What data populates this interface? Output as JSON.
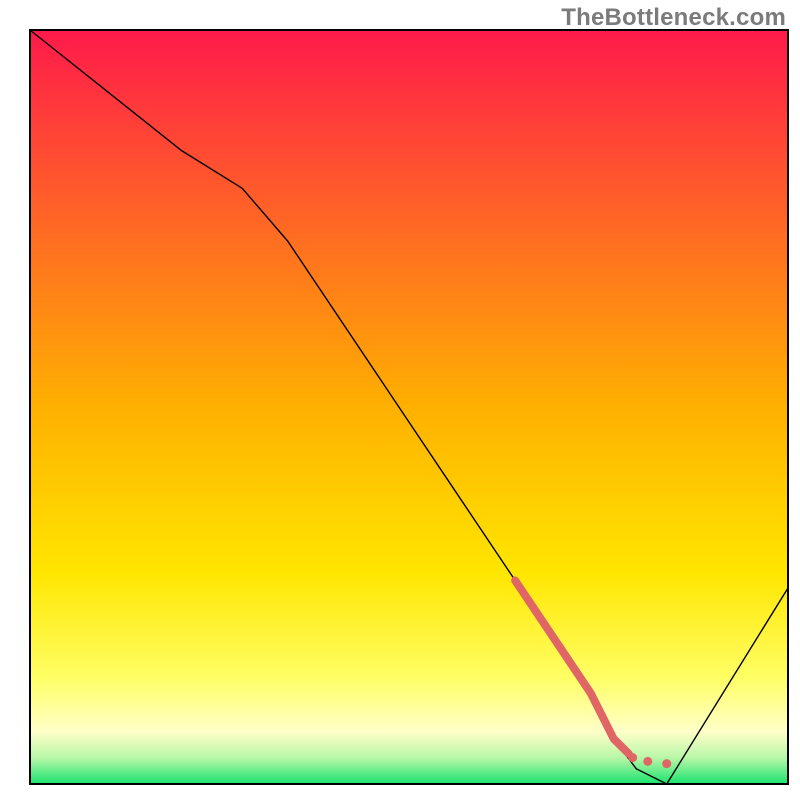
{
  "watermark": "TheBottleneck.com",
  "chart_data": {
    "type": "line",
    "title": "",
    "xlabel": "",
    "ylabel": "",
    "xlim": [
      0,
      100
    ],
    "ylim": [
      0,
      100
    ],
    "axes_visible": false,
    "background_gradient": {
      "orientation": "vertical",
      "stops": [
        {
          "offset": 0.0,
          "color": "#ff1a4b"
        },
        {
          "offset": 0.5,
          "color": "#ffb000"
        },
        {
          "offset": 0.72,
          "color": "#ffe600"
        },
        {
          "offset": 0.86,
          "color": "#ffff66"
        },
        {
          "offset": 0.93,
          "color": "#ffffc8"
        },
        {
          "offset": 0.965,
          "color": "#b9f7a8"
        },
        {
          "offset": 1.0,
          "color": "#19e36e"
        }
      ]
    },
    "series": [
      {
        "name": "bottleneck-curve",
        "color": "#000000",
        "stroke_width": 1.4,
        "x": [
          0,
          10,
          20,
          28,
          34,
          40,
          48,
          56,
          64,
          70,
          74,
          77,
          80,
          84,
          100
        ],
        "values": [
          100,
          92,
          84,
          79,
          72,
          63,
          51,
          39,
          27,
          18,
          12,
          6,
          2,
          0,
          26
        ]
      },
      {
        "name": "highlight-segment",
        "color": "#e06666",
        "stroke_width": 8,
        "style": "solid-then-dotted",
        "x": [
          64,
          70,
          74,
          77,
          79
        ],
        "values": [
          27,
          18,
          12,
          6,
          4
        ]
      }
    ],
    "highlight_dots": {
      "color": "#e06666",
      "radius": 4.5,
      "points": [
        {
          "x": 79.5,
          "y": 3.5
        },
        {
          "x": 81.5,
          "y": 3.0
        },
        {
          "x": 84.0,
          "y": 2.7
        }
      ]
    }
  }
}
